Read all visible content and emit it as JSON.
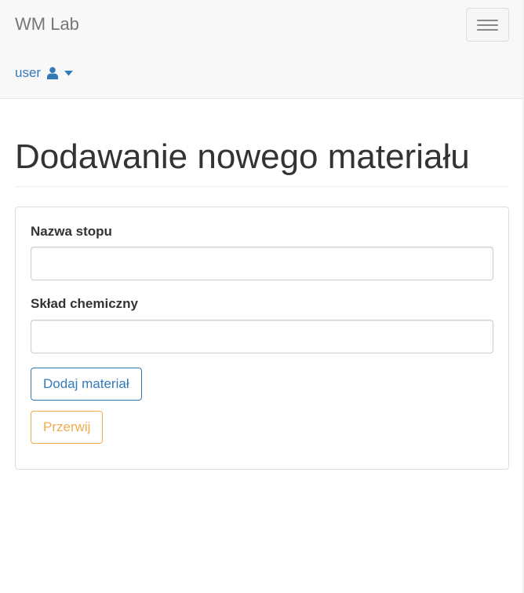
{
  "navbar": {
    "brand": "WM Lab",
    "toggle_icon": "hamburger-menu-icon",
    "user_menu": {
      "label": "user",
      "icon": "user-icon",
      "caret_icon": "caret-down-icon"
    }
  },
  "colors": {
    "link": "#337ab7",
    "warning": "#f0ad4e",
    "navbar_bg": "#f8f8f8"
  },
  "main": {
    "title": "Dodawanie nowego materiału",
    "form": {
      "alloy_name": {
        "label": "Nazwa stopu",
        "value": ""
      },
      "chemical_composition": {
        "label": "Skład chemiczny",
        "value": ""
      },
      "submit_label": "Dodaj materiał",
      "cancel_label": "Przerwij"
    }
  }
}
